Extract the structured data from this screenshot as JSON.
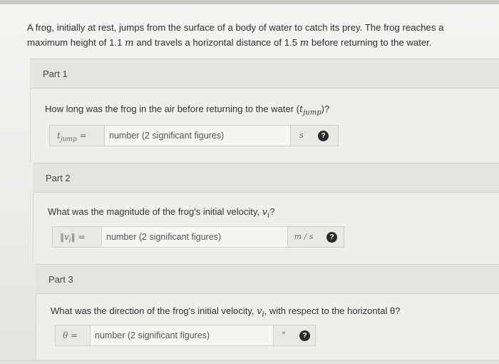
{
  "problem": {
    "text_line1_a": "A frog, initially at rest, jumps from the surface of a body of water to catch its prey. The frog reaches a",
    "text_line2_a": "maximum height of 1.1 ",
    "text_line2_unit1": "m",
    "text_line2_b": " and travels a horizontal distance of 1.5 ",
    "text_line2_unit2": "m",
    "text_line2_c": " before returning to the water."
  },
  "parts": [
    {
      "label": "Part 1",
      "question_pre": "How long was the frog in the air before returning to the water (",
      "question_var": "t",
      "question_sub": "jump",
      "question_post": ")?",
      "answer_label": "t",
      "answer_label_sub": "jump",
      "answer_eq": " =",
      "placeholder": "number (2 significant figures)",
      "unit": "s",
      "help_icon": "question-circle-icon"
    },
    {
      "label": "Part 2",
      "question_pre": "What was the magnitude of the frog's initial velocity, ",
      "question_var": "v",
      "question_sub": "i",
      "question_post": "?",
      "answer_label": "‖v",
      "answer_label_sub": "i",
      "answer_eq": "‖ =",
      "placeholder": "number (2 significant figures)",
      "unit": "m / s",
      "help_icon": "question-circle-icon"
    },
    {
      "label": "Part 3",
      "question_pre": "What was the direction of the frog's initial velocity, ",
      "question_var": "v",
      "question_sub": "i",
      "question_post": ", with respect to the horizontal θ?",
      "answer_label": "θ",
      "answer_label_sub": "",
      "answer_eq": " =",
      "placeholder": "number (2 significant figures)",
      "unit": "°",
      "help_icon": "question-circle-icon"
    }
  ],
  "help_glyph": "?"
}
